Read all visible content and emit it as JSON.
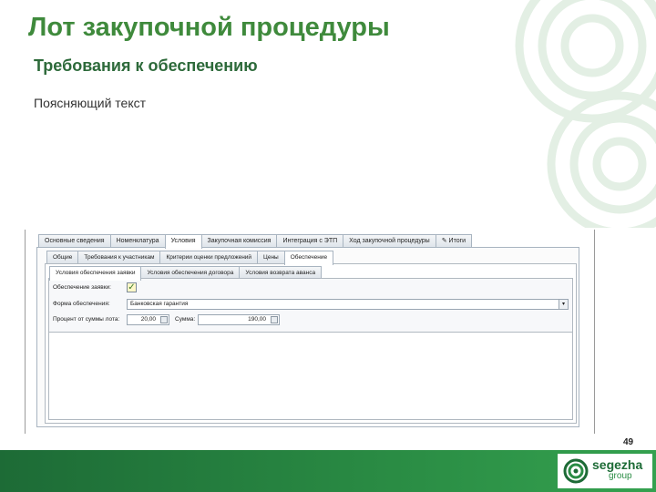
{
  "slide": {
    "title": "Лот закупочной процедуры",
    "subtitle": "Требования к обеспечению",
    "note": "Поясняющий текст",
    "page_number": "49"
  },
  "brand": {
    "name": "segezha",
    "sub": "group",
    "colors": {
      "green_dark": "#1d6b36",
      "green": "#3f8a3c"
    }
  },
  "tabs_main": [
    {
      "label": "Основные сведения",
      "active": false
    },
    {
      "label": "Номенклатура",
      "active": false
    },
    {
      "label": "Условия",
      "active": true
    },
    {
      "label": "Закупочная комиссия",
      "active": false
    },
    {
      "label": "Интеграция с ЭТП",
      "active": false
    },
    {
      "label": "Ход закупочной процедуры",
      "active": false
    },
    {
      "label": "Итоги",
      "active": false
    }
  ],
  "tabs_conditions": [
    {
      "label": "Общие",
      "active": false
    },
    {
      "label": "Требования к участникам",
      "active": false
    },
    {
      "label": "Критерии оценки предложений",
      "active": false
    },
    {
      "label": "Цены",
      "active": false
    },
    {
      "label": "Обеспечение",
      "active": true
    }
  ],
  "tabs_security": [
    {
      "label": "Условия обеспечения заявки",
      "active": true
    },
    {
      "label": "Условия обеспечения договора",
      "active": false
    },
    {
      "label": "Условия возврата аванса",
      "active": false
    }
  ],
  "form": {
    "security_label": "Обеспечение заявки:",
    "security_checked": true,
    "form_label": "Форма обеспечения:",
    "form_value": "Банковская гарантия",
    "percent_label": "Процент от суммы лота:",
    "percent_value": "20,00",
    "sum_label": "Сумма:",
    "sum_value": "190,00"
  }
}
